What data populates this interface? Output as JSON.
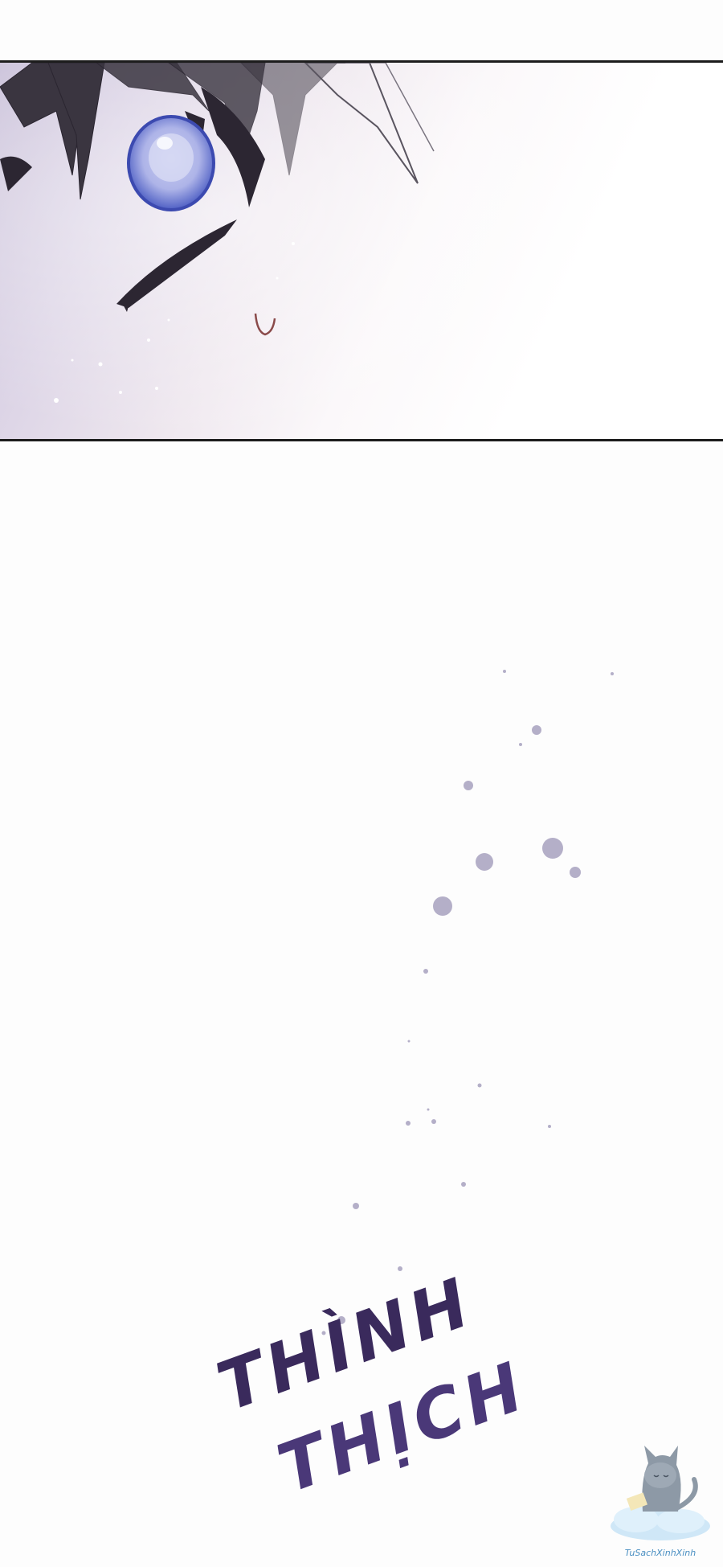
{
  "panels": {
    "top": {
      "description_hidden": "",
      "colors": {
        "background_left": "#c9c0d9",
        "background_right": "#ffffff",
        "iris": "#4e5fc4",
        "iris_highlight": "#c9cdf0",
        "hair": "#3a3540",
        "border": "#1c1c1c"
      }
    }
  },
  "sfx": {
    "line1": "THÌNH",
    "line2": "THỊCH",
    "color": "#3a2a5c"
  },
  "watermark": {
    "text": "TuSachXinhXinh",
    "icon": "cat-on-cloud-icon"
  }
}
